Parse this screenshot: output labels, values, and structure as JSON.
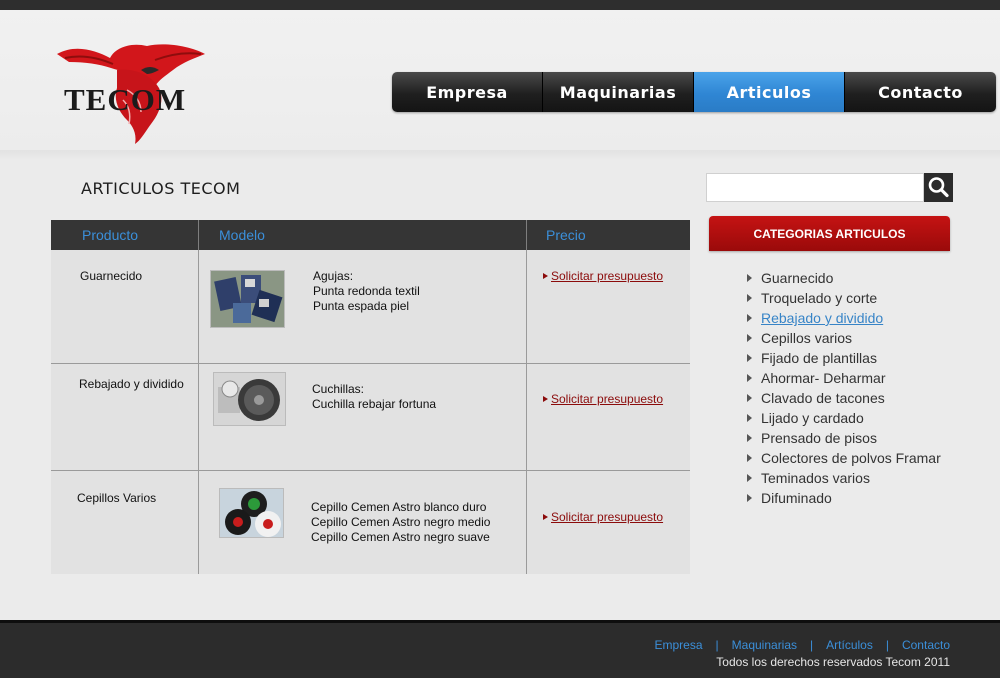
{
  "brand": {
    "name": "TECOM"
  },
  "nav": {
    "items": [
      {
        "label": "Empresa"
      },
      {
        "label": "Maquinarias"
      },
      {
        "label": "Articulos"
      },
      {
        "label": "Contacto"
      }
    ],
    "active_label": "Articulos"
  },
  "page": {
    "title": "ARTICULOS TECOM"
  },
  "table": {
    "headers": {
      "producto": "Producto",
      "modelo": "Modelo",
      "precio": "Precio"
    },
    "rows": [
      {
        "producto": "Guarnecido",
        "modelo": [
          "Agujas:",
          "Punta redonda textil",
          "Punta espada piel"
        ],
        "precio": "Solicitar presupuesto"
      },
      {
        "producto": "Rebajado y dividido",
        "modelo": [
          "Cuchillas:",
          "Cuchilla rebajar fortuna"
        ],
        "precio": "Solicitar presupuesto"
      },
      {
        "producto": "Cepillos Varios",
        "modelo": [
          "Cepillo Cemen Astro blanco duro",
          "Cepillo Cemen Astro negro medio",
          "Cepillo Cemen Astro negro suave"
        ],
        "precio": "Solicitar presupuesto"
      }
    ]
  },
  "search": {
    "value": "",
    "icon": "search-icon"
  },
  "sidebar": {
    "header": "CATEGORIAS ARTICULOS",
    "items": [
      "Guarnecido",
      "Troquelado y  corte",
      "Rebajado y dividido",
      "Cepillos varios",
      "Fijado de plantillas",
      "Ahormar- Deharmar",
      "Clavado de  tacones",
      "Lijado y cardado",
      "Prensado de pisos",
      "Colectores de polvos Framar",
      "Teminados varios",
      "Difuminado"
    ],
    "active_item": "Rebajado y dividido"
  },
  "footer": {
    "links": [
      "Empresa",
      "Maquinarias",
      "Artículos",
      "Contacto"
    ],
    "separator": "|",
    "copyright": "Todos los derechos reservados Tecom 2011"
  },
  "colors": {
    "accent_blue": "#3b8fd9",
    "brand_red": "#c51313",
    "link_red": "#8b0b0b",
    "dark": "#2c2c2c"
  }
}
